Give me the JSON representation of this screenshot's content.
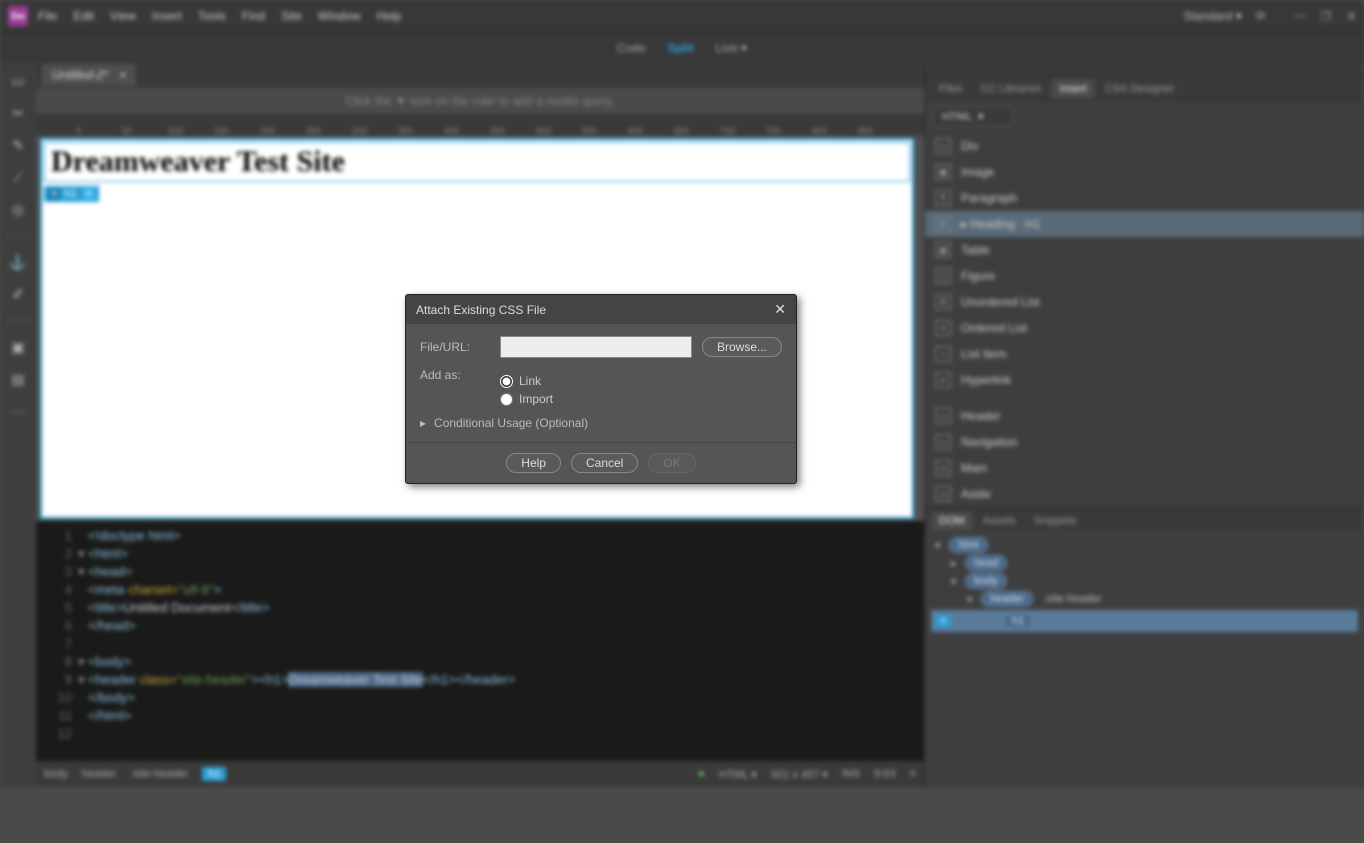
{
  "app_logo_text": "Dw",
  "menubar": [
    "File",
    "Edit",
    "View",
    "Insert",
    "Tools",
    "Find",
    "Site",
    "Window",
    "Help"
  ],
  "workspace": "Standard",
  "sync_icon": "sync",
  "window_controls": [
    "—",
    "❐",
    "✕"
  ],
  "view_switcher": {
    "code": "Code",
    "split": "Split",
    "live": "Live",
    "active": "Split"
  },
  "doc_tab": {
    "name": "Untitled-2*",
    "close": "×"
  },
  "left_tools": [
    {
      "name": "selection",
      "glyph": "▭"
    },
    {
      "name": "crop",
      "glyph": "✂"
    },
    {
      "name": "dropper",
      "glyph": "✎"
    },
    {
      "name": "slash",
      "glyph": "⟋"
    },
    {
      "name": "target",
      "glyph": "◎"
    },
    {
      "name": "div"
    },
    {
      "name": "anchor",
      "glyph": "⚓"
    },
    {
      "name": "brush",
      "glyph": "✐"
    },
    {
      "name": "div"
    },
    {
      "name": "device",
      "glyph": "▣"
    },
    {
      "name": "screen",
      "glyph": "▤"
    },
    {
      "name": "ellipsis",
      "glyph": "···"
    }
  ],
  "ruler_msg": "Click the ▼ icon on the ruler to add a media query.",
  "ruler_marks": [
    "0",
    "50",
    "100",
    "150",
    "200",
    "250",
    "300",
    "350",
    "400",
    "450",
    "500",
    "550",
    "600",
    "650",
    "700",
    "750",
    "800",
    "850"
  ],
  "design_heading": "Dreamweaver Test Site",
  "tag_badge": {
    "prefix": "≡",
    "label": "h1",
    "plus": "+"
  },
  "code_lines": [
    {
      "n": 1,
      "f": "",
      "html": "<span class='tok-tag'>&lt;!doctype html&gt;</span>"
    },
    {
      "n": 2,
      "f": "▾",
      "html": "<span class='tok-tag'>&lt;html&gt;</span>"
    },
    {
      "n": 3,
      "f": "▾",
      "html": "<span class='tok-tag'>&lt;head&gt;</span>"
    },
    {
      "n": 4,
      "f": "",
      "html": "<span class='tok-tag'>&lt;meta</span> <span class='tok-attr'>charset=</span><span class='tok-val'>\"utf-8\"</span><span class='tok-tag'>&gt;</span>"
    },
    {
      "n": 5,
      "f": "",
      "html": "<span class='tok-tag'>&lt;title&gt;</span><span class='tok-text'>Untitled Document</span><span class='tok-tag'>&lt;/title&gt;</span>"
    },
    {
      "n": 6,
      "f": "",
      "html": "<span class='tok-tag'>&lt;/head&gt;</span>"
    },
    {
      "n": 7,
      "f": "",
      "html": ""
    },
    {
      "n": 8,
      "f": "▾",
      "html": "<span class='tok-tag'>&lt;body&gt;</span>"
    },
    {
      "n": 9,
      "f": "▾",
      "html": "<span class='tok-tag'>&lt;header</span> <span class='tok-attr'>class=</span><span class='tok-val'>\"site-header\"</span><span class='tok-tag'>&gt;&lt;h1&gt;</span><span class='sel tok-text'>Dreamweaver Test Site</span><span class='tok-tag'>&lt;/h1&gt;&lt;/header&gt;</span>"
    },
    {
      "n": 10,
      "f": "",
      "html": "<span class='tok-tag'>&lt;/body&gt;</span>"
    },
    {
      "n": 11,
      "f": "",
      "html": "<span class='tok-tag'>&lt;/html&gt;</span>"
    },
    {
      "n": 12,
      "f": "",
      "html": ""
    }
  ],
  "statusbar": {
    "path": [
      "body",
      "header",
      ".site-header"
    ],
    "sel": "h1",
    "sync": "●",
    "doctype": "HTML",
    "size": "921 x 457",
    "ins": "INS",
    "pos": "9:63",
    "menu": "≡"
  },
  "right_top_tabs": [
    "Files",
    "CC Libraries",
    "Insert",
    "CSS Designer"
  ],
  "right_top_active": "Insert",
  "insert_category": "HTML",
  "insert_items": [
    {
      "label": "Div",
      "icon": "▭"
    },
    {
      "label": "Image",
      "icon": "▣"
    },
    {
      "label": "Paragraph",
      "icon": "¶"
    },
    {
      "label": "Heading : H1",
      "icon": "H",
      "selected": true,
      "chev": true
    },
    {
      "label": "Table",
      "icon": "▦"
    },
    {
      "label": "Figure",
      "icon": "▢"
    },
    {
      "label": "Unordered List",
      "icon": "☰"
    },
    {
      "label": "Ordered List",
      "icon": "≡"
    },
    {
      "label": "List Item",
      "icon": "•"
    },
    {
      "label": "Hyperlink",
      "icon": "∞"
    },
    {
      "sep": true
    },
    {
      "label": "Header",
      "icon": "▭"
    },
    {
      "label": "Navigation",
      "icon": "▭"
    },
    {
      "label": "Main",
      "icon": "▭"
    },
    {
      "label": "Aside",
      "icon": "▭"
    }
  ],
  "dom_tabs": [
    "DOM",
    "Assets",
    "Snippets"
  ],
  "dom_active": "DOM",
  "dom_tree": {
    "html": "html",
    "head": "head",
    "body": "body",
    "header": "header",
    "h1": "h1",
    "cls": ".site-header",
    "add": "+"
  },
  "dialog": {
    "title": "Attach Existing CSS File",
    "close": "✕",
    "file_label": "File/URL:",
    "file_value": "",
    "browse": "Browse...",
    "addas_label": "Add as:",
    "radio_link": "Link",
    "radio_import": "Import",
    "conditional": "Conditional Usage (Optional)",
    "help": "Help",
    "cancel": "Cancel",
    "ok": "OK"
  }
}
